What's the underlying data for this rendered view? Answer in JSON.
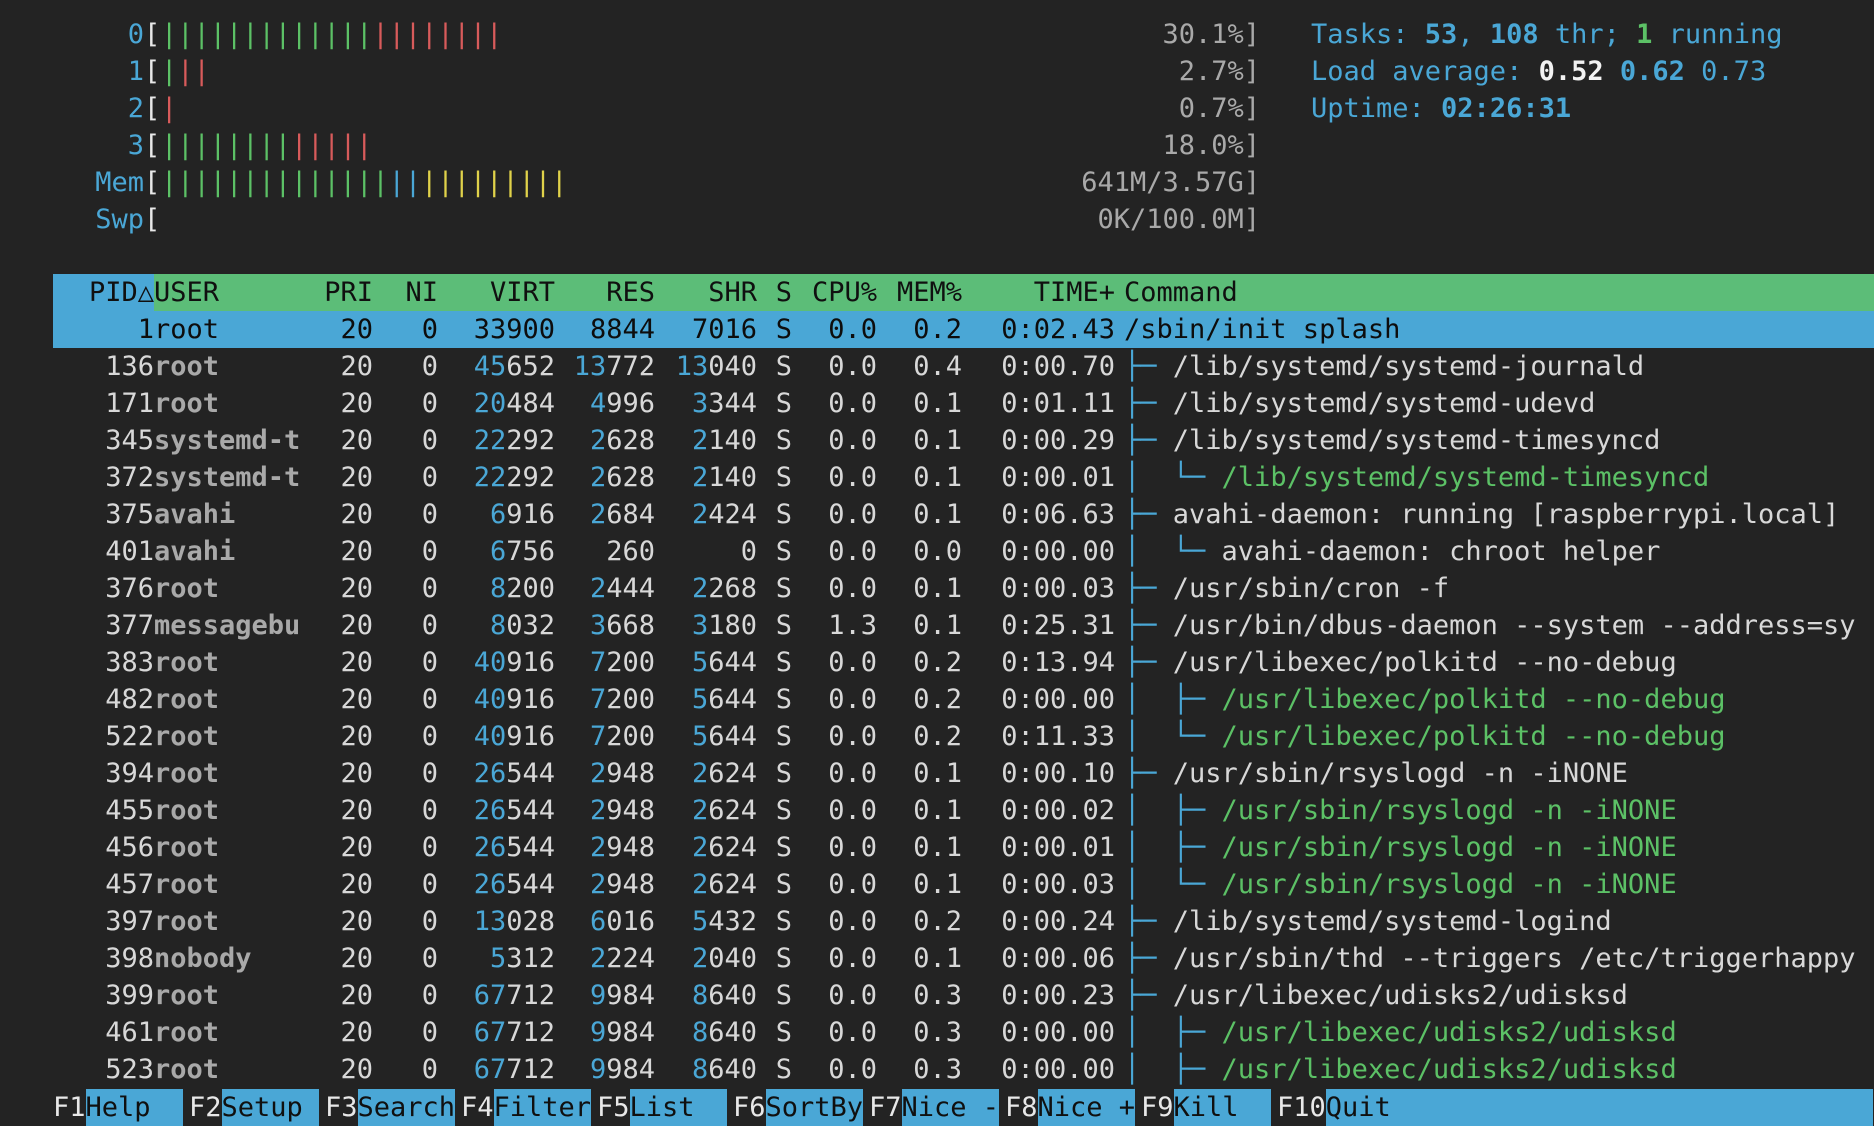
{
  "meters": {
    "cpus": [
      {
        "id": "0",
        "value": "30.1%]",
        "bars": [
          {
            "color": "green",
            "count": 13
          },
          {
            "color": "red",
            "count": 8
          }
        ]
      },
      {
        "id": "1",
        "value": "2.7%]",
        "bars": [
          {
            "color": "green",
            "count": 1
          },
          {
            "color": "red",
            "count": 2
          }
        ]
      },
      {
        "id": "2",
        "value": "0.7%]",
        "bars": [
          {
            "color": "red",
            "count": 1
          }
        ]
      },
      {
        "id": "3",
        "value": "18.0%]",
        "bars": [
          {
            "color": "green",
            "count": 8
          },
          {
            "color": "red",
            "count": 5
          }
        ]
      }
    ],
    "mem": {
      "label": "Mem",
      "value": "641M/3.57G]",
      "bars": [
        {
          "color": "green",
          "count": 14
        },
        {
          "color": "cyan",
          "count": 2
        },
        {
          "color": "yellow",
          "count": 9
        }
      ]
    },
    "swp": {
      "label": "Swp",
      "value": "0K/100.0M]",
      "bars": []
    }
  },
  "summary": {
    "tasks_label": "Tasks: ",
    "tasks_count": "53",
    "threads_sep": ", ",
    "threads_count": "108",
    "threads_label": " thr; ",
    "running_count": "1",
    "running_label": " running",
    "load_label": "Load average: ",
    "load_1": "0.52",
    "load_5": "0.62",
    "load_15": "0.73",
    "uptime_label": "Uptime: ",
    "uptime_value": "02:26:31"
  },
  "table": {
    "headers": {
      "pid": "PID△",
      "user": "USER",
      "pri": "PRI",
      "ni": "NI",
      "virt": "VIRT",
      "res": "RES",
      "shr": "SHR",
      "s": "S",
      "cpu": "CPU%",
      "mem": "MEM%",
      "time": "TIME+",
      "command": "Command"
    },
    "rows": [
      {
        "pid": "1",
        "user": "root",
        "pri": "20",
        "ni": "0",
        "virt": "33900",
        "res": "8844",
        "shr": "7016",
        "s": "S",
        "cpu": "0.0",
        "mem": "0.2",
        "time": "0:02.43",
        "tree": "",
        "command": "/sbin/init splash",
        "thread": false
      },
      {
        "pid": "136",
        "user": "root",
        "pri": "20",
        "ni": "0",
        "virt": "45652",
        "res": "13772",
        "shr": "13040",
        "s": "S",
        "cpu": "0.0",
        "mem": "0.4",
        "time": "0:00.70",
        "tree": "├─ ",
        "command": "/lib/systemd/systemd-journald",
        "thread": false
      },
      {
        "pid": "171",
        "user": "root",
        "pri": "20",
        "ni": "0",
        "virt": "20484",
        "res": "4996",
        "shr": "3344",
        "s": "S",
        "cpu": "0.0",
        "mem": "0.1",
        "time": "0:01.11",
        "tree": "├─ ",
        "command": "/lib/systemd/systemd-udevd",
        "thread": false
      },
      {
        "pid": "345",
        "user": "systemd-t",
        "pri": "20",
        "ni": "0",
        "virt": "22292",
        "res": "2628",
        "shr": "2140",
        "s": "S",
        "cpu": "0.0",
        "mem": "0.1",
        "time": "0:00.29",
        "tree": "├─ ",
        "command": "/lib/systemd/systemd-timesyncd",
        "thread": false
      },
      {
        "pid": "372",
        "user": "systemd-t",
        "pri": "20",
        "ni": "0",
        "virt": "22292",
        "res": "2628",
        "shr": "2140",
        "s": "S",
        "cpu": "0.0",
        "mem": "0.1",
        "time": "0:00.01",
        "tree": "│  └─ ",
        "command": "/lib/systemd/systemd-timesyncd",
        "thread": true
      },
      {
        "pid": "375",
        "user": "avahi",
        "pri": "20",
        "ni": "0",
        "virt": "6916",
        "res": "2684",
        "shr": "2424",
        "s": "S",
        "cpu": "0.0",
        "mem": "0.1",
        "time": "0:06.63",
        "tree": "├─ ",
        "command": "avahi-daemon: running [raspberrypi.local]",
        "thread": false
      },
      {
        "pid": "401",
        "user": "avahi",
        "pri": "20",
        "ni": "0",
        "virt": "6756",
        "res": "260",
        "shr": "0",
        "s": "S",
        "cpu": "0.0",
        "mem": "0.0",
        "time": "0:00.00",
        "tree": "│  └─ ",
        "command": "avahi-daemon: chroot helper",
        "thread": false
      },
      {
        "pid": "376",
        "user": "root",
        "pri": "20",
        "ni": "0",
        "virt": "8200",
        "res": "2444",
        "shr": "2268",
        "s": "S",
        "cpu": "0.0",
        "mem": "0.1",
        "time": "0:00.03",
        "tree": "├─ ",
        "command": "/usr/sbin/cron -f",
        "thread": false
      },
      {
        "pid": "377",
        "user": "messagebu",
        "pri": "20",
        "ni": "0",
        "virt": "8032",
        "res": "3668",
        "shr": "3180",
        "s": "S",
        "cpu": "1.3",
        "mem": "0.1",
        "time": "0:25.31",
        "tree": "├─ ",
        "command": "/usr/bin/dbus-daemon --system --address=sy",
        "thread": false
      },
      {
        "pid": "383",
        "user": "root",
        "pri": "20",
        "ni": "0",
        "virt": "40916",
        "res": "7200",
        "shr": "5644",
        "s": "S",
        "cpu": "0.0",
        "mem": "0.2",
        "time": "0:13.94",
        "tree": "├─ ",
        "command": "/usr/libexec/polkitd --no-debug",
        "thread": false
      },
      {
        "pid": "482",
        "user": "root",
        "pri": "20",
        "ni": "0",
        "virt": "40916",
        "res": "7200",
        "shr": "5644",
        "s": "S",
        "cpu": "0.0",
        "mem": "0.2",
        "time": "0:00.00",
        "tree": "│  ├─ ",
        "command": "/usr/libexec/polkitd --no-debug",
        "thread": true
      },
      {
        "pid": "522",
        "user": "root",
        "pri": "20",
        "ni": "0",
        "virt": "40916",
        "res": "7200",
        "shr": "5644",
        "s": "S",
        "cpu": "0.0",
        "mem": "0.2",
        "time": "0:11.33",
        "tree": "│  └─ ",
        "command": "/usr/libexec/polkitd --no-debug",
        "thread": true
      },
      {
        "pid": "394",
        "user": "root",
        "pri": "20",
        "ni": "0",
        "virt": "26544",
        "res": "2948",
        "shr": "2624",
        "s": "S",
        "cpu": "0.0",
        "mem": "0.1",
        "time": "0:00.10",
        "tree": "├─ ",
        "command": "/usr/sbin/rsyslogd -n -iNONE",
        "thread": false
      },
      {
        "pid": "455",
        "user": "root",
        "pri": "20",
        "ni": "0",
        "virt": "26544",
        "res": "2948",
        "shr": "2624",
        "s": "S",
        "cpu": "0.0",
        "mem": "0.1",
        "time": "0:00.02",
        "tree": "│  ├─ ",
        "command": "/usr/sbin/rsyslogd -n -iNONE",
        "thread": true
      },
      {
        "pid": "456",
        "user": "root",
        "pri": "20",
        "ni": "0",
        "virt": "26544",
        "res": "2948",
        "shr": "2624",
        "s": "S",
        "cpu": "0.0",
        "mem": "0.1",
        "time": "0:00.01",
        "tree": "│  ├─ ",
        "command": "/usr/sbin/rsyslogd -n -iNONE",
        "thread": true
      },
      {
        "pid": "457",
        "user": "root",
        "pri": "20",
        "ni": "0",
        "virt": "26544",
        "res": "2948",
        "shr": "2624",
        "s": "S",
        "cpu": "0.0",
        "mem": "0.1",
        "time": "0:00.03",
        "tree": "│  └─ ",
        "command": "/usr/sbin/rsyslogd -n -iNONE",
        "thread": true
      },
      {
        "pid": "397",
        "user": "root",
        "pri": "20",
        "ni": "0",
        "virt": "13028",
        "res": "6016",
        "shr": "5432",
        "s": "S",
        "cpu": "0.0",
        "mem": "0.2",
        "time": "0:00.24",
        "tree": "├─ ",
        "command": "/lib/systemd/systemd-logind",
        "thread": false
      },
      {
        "pid": "398",
        "user": "nobody",
        "pri": "20",
        "ni": "0",
        "virt": "5312",
        "res": "2224",
        "shr": "2040",
        "s": "S",
        "cpu": "0.0",
        "mem": "0.1",
        "time": "0:00.06",
        "tree": "├─ ",
        "command": "/usr/sbin/thd --triggers /etc/triggerhappy",
        "thread": false
      },
      {
        "pid": "399",
        "user": "root",
        "pri": "20",
        "ni": "0",
        "virt": "67712",
        "res": "9984",
        "shr": "8640",
        "s": "S",
        "cpu": "0.0",
        "mem": "0.3",
        "time": "0:00.23",
        "tree": "├─ ",
        "command": "/usr/libexec/udisks2/udisksd",
        "thread": false
      },
      {
        "pid": "461",
        "user": "root",
        "pri": "20",
        "ni": "0",
        "virt": "67712",
        "res": "9984",
        "shr": "8640",
        "s": "S",
        "cpu": "0.0",
        "mem": "0.3",
        "time": "0:00.00",
        "tree": "│  ├─ ",
        "command": "/usr/libexec/udisks2/udisksd",
        "thread": true
      },
      {
        "pid": "523",
        "user": "root",
        "pri": "20",
        "ni": "0",
        "virt": "67712",
        "res": "9984",
        "shr": "8640",
        "s": "S",
        "cpu": "0.0",
        "mem": "0.3",
        "time": "0:00.00",
        "tree": "│  ├─ ",
        "command": "/usr/libexec/udisks2/udisksd",
        "thread": true
      }
    ]
  },
  "fkeys": [
    {
      "key": "F1",
      "label": "Help  "
    },
    {
      "key": "F2",
      "label": "Setup "
    },
    {
      "key": "F3",
      "label": "Search"
    },
    {
      "key": "F4",
      "label": "Filter"
    },
    {
      "key": "F5",
      "label": "List  "
    },
    {
      "key": "F6",
      "label": "SortBy"
    },
    {
      "key": "F7",
      "label": "Nice -"
    },
    {
      "key": "F8",
      "label": "Nice +"
    },
    {
      "key": "F9",
      "label": "Kill  "
    },
    {
      "key": "F10",
      "label": "Quit"
    }
  ],
  "colors": {
    "background": "#232323",
    "cyan": "#4aa7d6",
    "green": "#5cc166",
    "red": "#d85b5b",
    "yellow": "#e0d24a",
    "header_bg": "#5cbd78",
    "selected_bg": "#4aa7d6"
  }
}
